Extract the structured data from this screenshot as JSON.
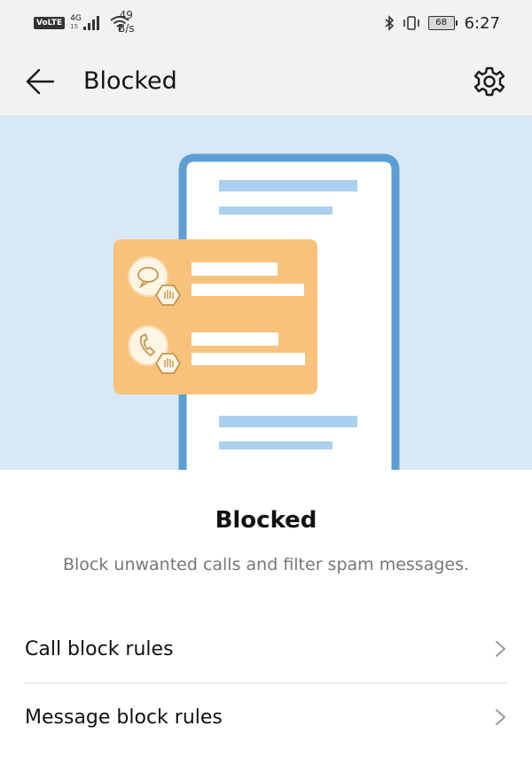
{
  "status_bar": {
    "volte": "VoLTE",
    "network": "4G",
    "network_sub": "15",
    "speed_value": "49",
    "speed_unit": "B/s",
    "battery": "68",
    "time": "6:27"
  },
  "app_bar": {
    "title": "Blocked",
    "back_icon": "arrow-left-icon",
    "settings_icon": "gear-icon"
  },
  "content": {
    "title": "Blocked",
    "description": "Block unwanted calls and filter spam messages."
  },
  "rules": [
    {
      "label": "Call block rules"
    },
    {
      "label": "Message block rules"
    }
  ],
  "colors": {
    "hero_bg": "#d8e8f6",
    "phone_frame": "#5d9fd3",
    "card": "#f7c37c",
    "placeholder_line": "#a9d0ee"
  }
}
